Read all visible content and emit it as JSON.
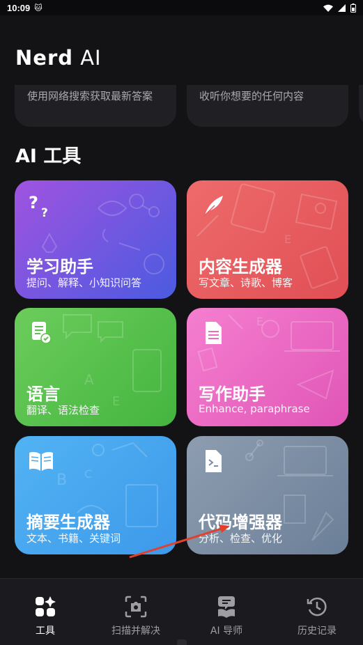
{
  "status_bar": {
    "time": "10:09"
  },
  "header": {
    "title_bold": "Nerd",
    "title_light": "AI"
  },
  "top_cards": [
    {
      "desc": "使用网络搜索获取最新答案"
    },
    {
      "desc": "收听你想要的任何内容"
    }
  ],
  "section_title": "AI 工具",
  "tools": [
    {
      "name": "学习助手",
      "sub": "提问、解释、小知识问答",
      "color_a": "#a053e0",
      "color_b": "#4a5be0",
      "icon": "question-icon"
    },
    {
      "name": "内容生成器",
      "sub": "写文章、诗歌、博客",
      "color_a": "#ee6b6b",
      "color_b": "#e04f55",
      "icon": "feather-icon"
    },
    {
      "name": "语言",
      "sub": "翻译、语法检查",
      "color_a": "#6ccc5c",
      "color_b": "#44b53f",
      "icon": "document-check-icon"
    },
    {
      "name": "写作助手",
      "sub": "Enhance, paraphrase",
      "color_a": "#f57fd0",
      "color_b": "#e055b6",
      "icon": "document-icon"
    },
    {
      "name": "摘要生成器",
      "sub": "文本、书籍、关键词",
      "color_a": "#52b3f3",
      "color_b": "#3d99ea",
      "icon": "book-icon"
    },
    {
      "name": "代码增强器",
      "sub": "分析、检查、优化",
      "color_a": "#8e9db0",
      "color_b": "#6b7f98",
      "icon": "code-file-icon"
    }
  ],
  "nav": [
    {
      "label": "工具",
      "icon": "grid-sparkle-icon",
      "active": true
    },
    {
      "label": "扫描并解决",
      "icon": "camera-scan-icon",
      "active": false
    },
    {
      "label": "AI 导师",
      "icon": "tutor-icon",
      "active": false
    },
    {
      "label": "历史记录",
      "icon": "history-icon",
      "active": false
    }
  ],
  "colors": {
    "background": "#131316",
    "card_dark": "#202024",
    "arrow": "#e0412f"
  }
}
